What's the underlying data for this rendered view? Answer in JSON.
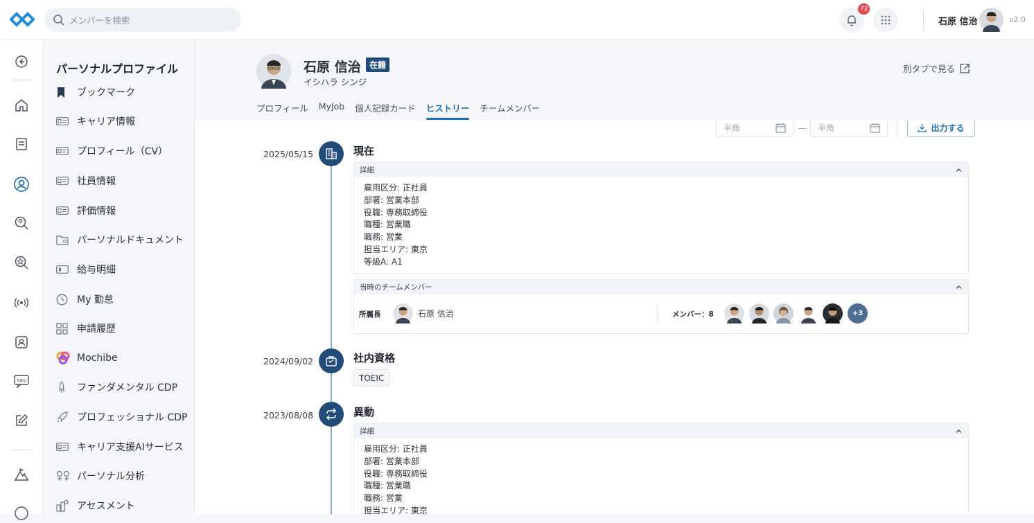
{
  "topbar": {
    "search_placeholder": "メンバーを検索",
    "notification_count": "72",
    "user_name": "石原 信治",
    "version": "v2.0"
  },
  "sidebar": {
    "title": "パーソナルプロファイル",
    "items": [
      {
        "label": "ブックマーク",
        "icon": "bookmark-icon"
      },
      {
        "label": "キャリア情報",
        "icon": "id-card-icon"
      },
      {
        "label": "プロフィール（CV）",
        "icon": "id-card-icon"
      },
      {
        "label": "社員情報",
        "icon": "id-card-icon"
      },
      {
        "label": "評価情報",
        "icon": "id-card-icon"
      },
      {
        "label": "パーソナルドキュメント",
        "icon": "folder-icon"
      },
      {
        "label": "給与明細",
        "icon": "payslip-icon"
      },
      {
        "label": "My 勤怠",
        "icon": "clock-icon"
      },
      {
        "label": "申請履歴",
        "icon": "grid-icon"
      },
      {
        "label": "Mochibe",
        "icon": "mochibe-logo-icon"
      },
      {
        "label": "ファンダメンタル CDP",
        "icon": "rocket-icon"
      },
      {
        "label": "プロフェッショナル CDP",
        "icon": "rocket-icon"
      },
      {
        "label": "キャリア支援AIサービス",
        "icon": "id-card-icon"
      },
      {
        "label": "パーソナル分析",
        "icon": "analysis-icon"
      },
      {
        "label": "アセスメント",
        "icon": "assessment-icon"
      }
    ]
  },
  "profile": {
    "name": "石原 信治",
    "status": "在籍",
    "kana": "イシハラ シンジ",
    "open_new_tab": "別タブで見る",
    "tabs": [
      "プロフィール",
      "MyJob",
      "個人記録カード",
      "ヒストリー",
      "チームメンバー"
    ],
    "active_tab": "ヒストリー"
  },
  "filters": {
    "date_from_placeholder": "半角",
    "date_to_placeholder": "半角",
    "separator": "—",
    "export_label": "出力する"
  },
  "timeline": [
    {
      "date": "2025/05/15",
      "title": "現在",
      "icon": "building-icon",
      "details_header": "詳細",
      "details": [
        "雇用区分: 正社員",
        "部署: 営業本部",
        "役職: 専務取締役",
        "職種: 営業職",
        "職務: 営業",
        "担当エリア: 東京",
        "等級A: A1"
      ],
      "team_header": "当時のチームメンバー",
      "team_leader_label": "所属長",
      "team_leader_name": "石原 信治",
      "members_label": "メンバー：8",
      "members_more": "+3"
    },
    {
      "date": "2024/09/02",
      "title": "社内資格",
      "icon": "bag-icon",
      "tag": "TOEIC"
    },
    {
      "date": "2023/08/08",
      "title": "異動",
      "icon": "transfer-icon",
      "details_header": "詳細",
      "details": [
        "雇用区分: 正社員",
        "部署: 営業本部",
        "役職: 専務取締役",
        "職種: 営業職",
        "職務: 営業",
        "担当エリア: 東京"
      ]
    }
  ],
  "colors": {
    "accent": "#1f6fb2",
    "navy": "#234b78",
    "badge": "#e5484d"
  }
}
